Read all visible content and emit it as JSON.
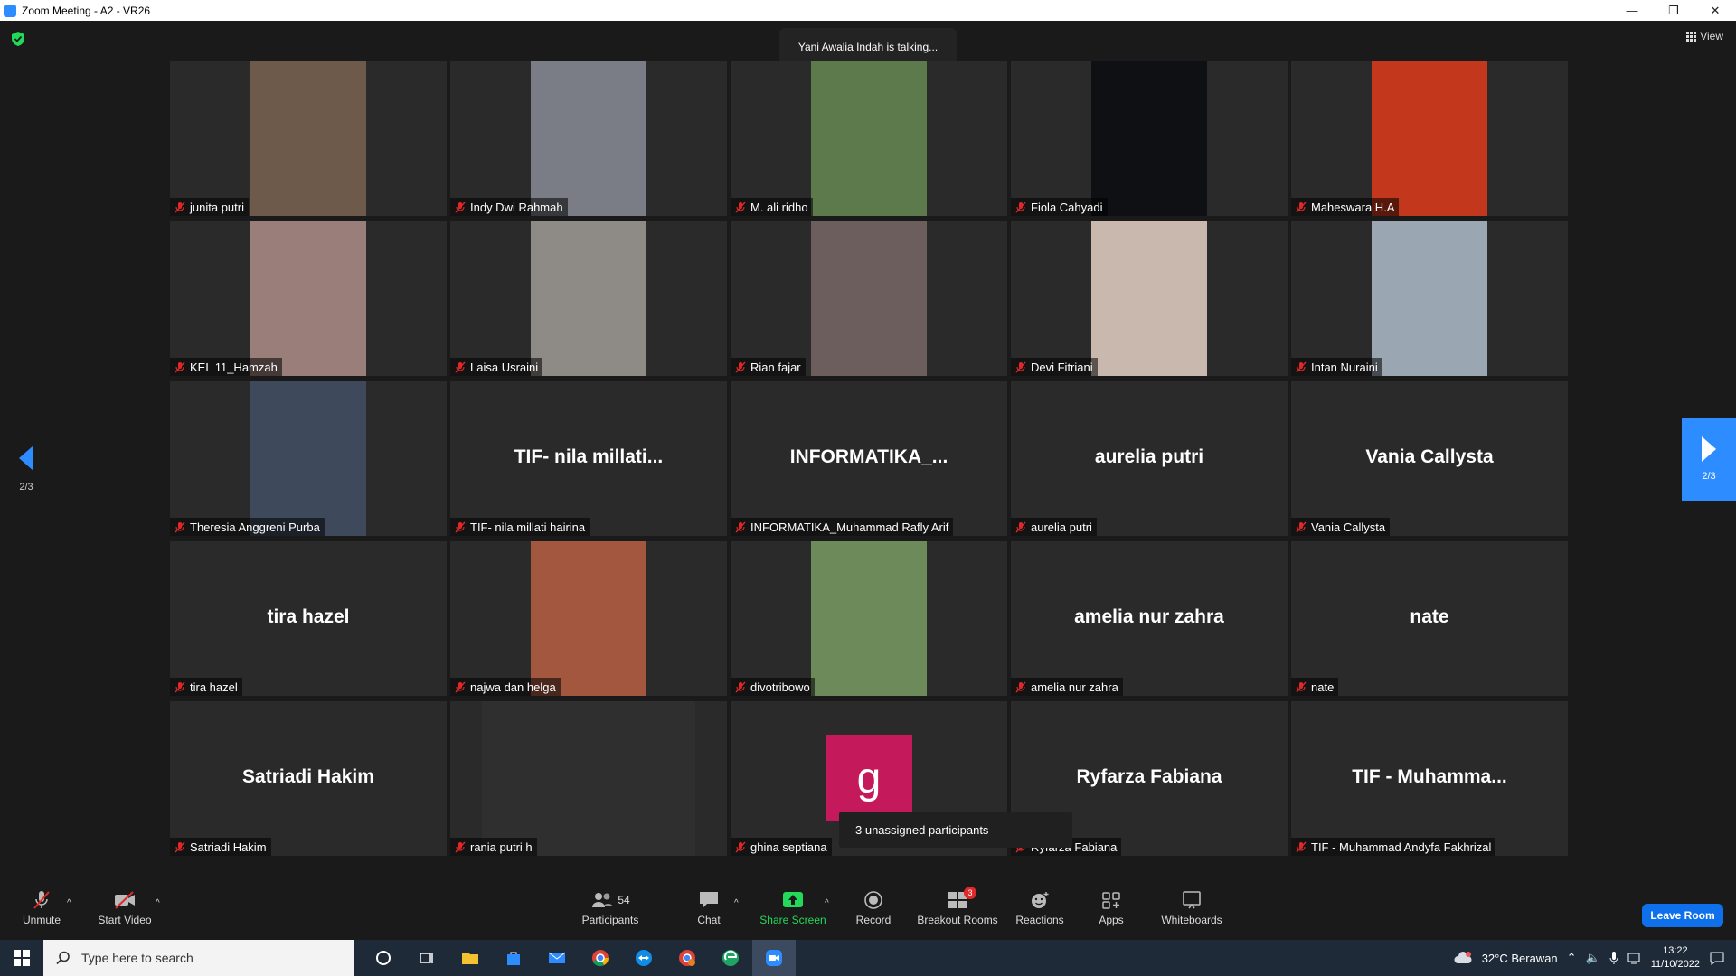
{
  "window": {
    "title": "Zoom Meeting - A2 - VR26",
    "minimize": "—",
    "restore": "❐",
    "close": "✕"
  },
  "meeting": {
    "talking_banner": "Yani Awalia Indah is talking...",
    "view_label": "View",
    "page_indicator_left": "2/3",
    "page_indicator_right": "2/3",
    "unassigned_popup": "3 unassigned participants"
  },
  "participants": [
    {
      "name": "junita putri",
      "video": "photo",
      "bg": "#6e5a4a"
    },
    {
      "name": "Indy Dwi Rahmah",
      "video": "photo",
      "bg": "#7b7d86"
    },
    {
      "name": "M. ali ridho",
      "video": "photo",
      "bg": "#5d7a4c"
    },
    {
      "name": "Fiola Cahyadi",
      "video": "photo",
      "bg": "#0e1014"
    },
    {
      "name": "Maheswara H.A",
      "video": "photo",
      "bg": "#c3381d"
    },
    {
      "name": "KEL 11_Hamzah",
      "video": "photo",
      "bg": "#9a7e7a"
    },
    {
      "name": "Laisa Usraini",
      "video": "photo",
      "bg": "#8e8a86"
    },
    {
      "name": "Rian fajar",
      "video": "photo",
      "bg": "#6c5e5c"
    },
    {
      "name": "Devi Fitriani",
      "video": "photo",
      "bg": "#c9b8ae"
    },
    {
      "name": "Intan Nuraini",
      "video": "photo",
      "bg": "#9aa7b3"
    },
    {
      "name": "Theresia Anggreni Purba",
      "video": "photo",
      "bg": "#3e4a5c"
    },
    {
      "name": "TIF- nila millati hairina",
      "video": "none",
      "display": "TIF- nila millati..."
    },
    {
      "name": "INFORMATIKA_Muhammad Rafly Arif",
      "video": "none",
      "display": "INFORMATIKA_..."
    },
    {
      "name": "aurelia putri",
      "video": "none",
      "display": "aurelia putri"
    },
    {
      "name": "Vania Callysta",
      "video": "none",
      "display": "Vania Callysta"
    },
    {
      "name": "tira hazel",
      "video": "none",
      "display": "tira hazel"
    },
    {
      "name": "najwa dan helga",
      "video": "photo",
      "bg": "#a3573f"
    },
    {
      "name": "divotribowo",
      "video": "photo",
      "bg": "#6d8a5b"
    },
    {
      "name": "amelia nur zahra",
      "video": "none",
      "display": "amelia nur zahra"
    },
    {
      "name": "nate",
      "video": "none",
      "display": "nate"
    },
    {
      "name": "Satriadi Hakim",
      "video": "none",
      "display": "Satriadi Hakim"
    },
    {
      "name": "rania putri h",
      "video": "dark",
      "bg": "#2f2f2f"
    },
    {
      "name": "ghina septiana",
      "video": "avatar",
      "avatar_letter": "g",
      "avatar_color": "#c4195a"
    },
    {
      "name": "Ryfarza Fabiana",
      "video": "none",
      "display": "Ryfarza Fabiana"
    },
    {
      "name": "TIF - Muhammad Andyfa Fakhrizal",
      "video": "none",
      "display": "TIF - Muhamma..."
    }
  ],
  "toolbar": {
    "unmute": "Unmute",
    "start_video": "Start Video",
    "participants": "Participants",
    "participants_count": "54",
    "chat": "Chat",
    "share_screen": "Share Screen",
    "record": "Record",
    "breakout_rooms": "Breakout Rooms",
    "breakout_badge": "3",
    "reactions": "Reactions",
    "apps": "Apps",
    "whiteboards": "Whiteboards",
    "leave_room": "Leave Room",
    "caret": "^"
  },
  "taskbar": {
    "search_placeholder": "Type here to search",
    "weather": "32°C  Berawan",
    "time": "13:22",
    "date": "11/10/2022"
  },
  "colors": {
    "accent": "#2d8cff",
    "leave": "#0e71eb",
    "share_green": "#23d959",
    "muted_red": "#e02828"
  }
}
